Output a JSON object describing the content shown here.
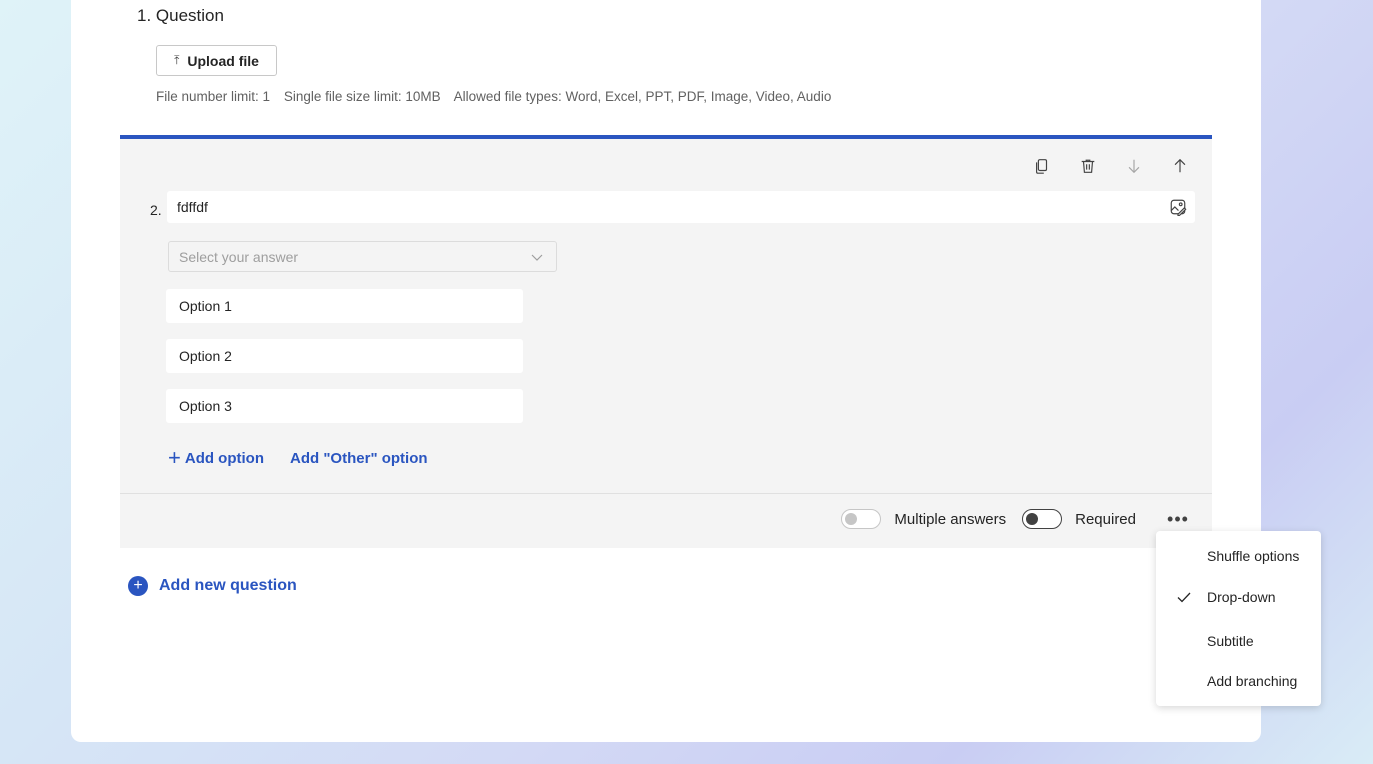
{
  "question1": {
    "number_title": "1. Question",
    "upload_label": "Upload file",
    "limits": [
      "File number limit: 1",
      "Single file size limit: 10MB",
      "Allowed file types: Word, Excel, PPT, PDF, Image, Video, Audio"
    ]
  },
  "question2": {
    "number": "2.",
    "title_value": "fdffdf",
    "answer_placeholder": "Select your answer",
    "options": [
      "Option 1",
      "Option 2",
      "Option 3"
    ],
    "add_option_label": "Add option",
    "add_other_label": "Add \"Other\" option",
    "multiple_answers_label": "Multiple answers",
    "multiple_answers_on": false,
    "required_label": "Required",
    "required_on": false,
    "more_label": "•••"
  },
  "add_new_question_label": "Add new question",
  "menu": {
    "items": [
      {
        "label": "Shuffle options",
        "checked": false
      },
      {
        "label": "Drop-down",
        "checked": true
      },
      {
        "label": "Subtitle",
        "checked": false
      },
      {
        "label": "Add branching",
        "checked": false
      }
    ]
  },
  "colors": {
    "accent": "#2a55c0",
    "card_bg": "#f4f4f4"
  }
}
